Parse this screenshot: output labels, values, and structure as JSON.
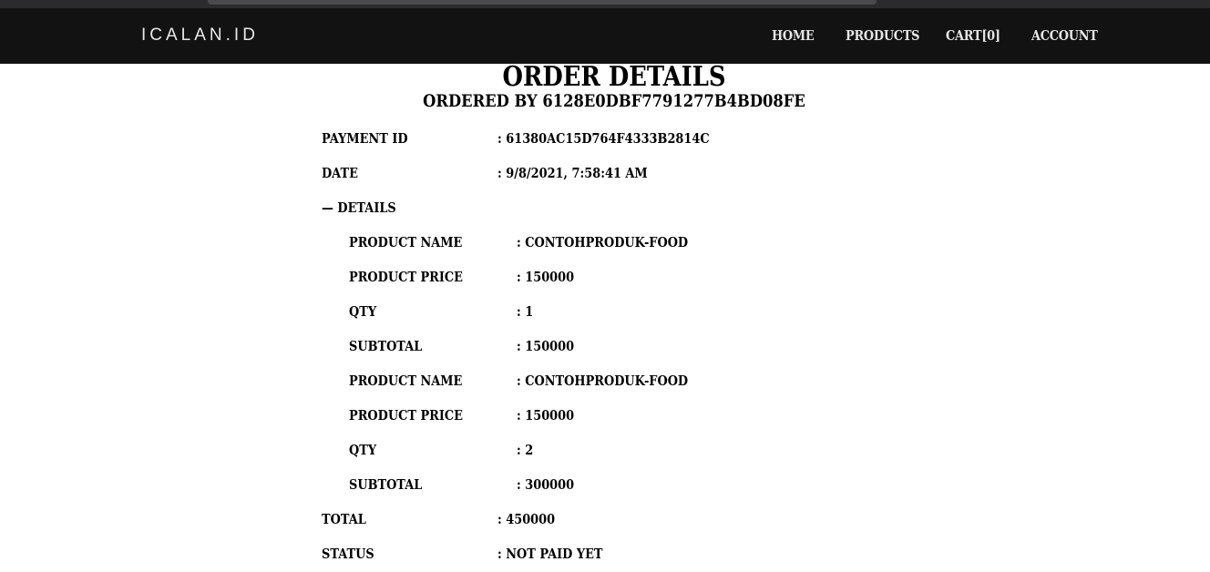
{
  "brand": "ICALAN.ID",
  "nav": {
    "home": "HOME",
    "products": "PRODUCTS",
    "cart": "CART[0]",
    "account": "ACCOUNT"
  },
  "order": {
    "title": "ORDER DETAILS",
    "subtitle": "ORDERED BY 6128E0DBF7791277B4BD08FE",
    "payment_id_label": "PAYMENT ID",
    "payment_id_value": ": 61380AC15D764F4333B2814C",
    "date_label": "DATE",
    "date_value": ": 9/8/2021, 7:58:41 AM",
    "details_toggle": "— DETAILS",
    "items": [
      {
        "name_label": "PRODUCT NAME",
        "name_value": ": CONTOHPRODUK-FOOD",
        "price_label": "PRODUCT PRICE",
        "price_value": ": 150000",
        "qty_label": "QTY",
        "qty_value": ": 1",
        "subtotal_label": "SUBTOTAL",
        "subtotal_value": ": 150000"
      },
      {
        "name_label": "PRODUCT NAME",
        "name_value": ": CONTOHPRODUK-FOOD",
        "price_label": "PRODUCT PRICE",
        "price_value": ": 150000",
        "qty_label": "QTY",
        "qty_value": ": 2",
        "subtotal_label": "SUBTOTAL",
        "subtotal_value": ": 300000"
      }
    ],
    "total_label": "TOTAL",
    "total_value": ": 450000",
    "status_label": "STATUS",
    "status_value": ": NOT PAID YET"
  }
}
